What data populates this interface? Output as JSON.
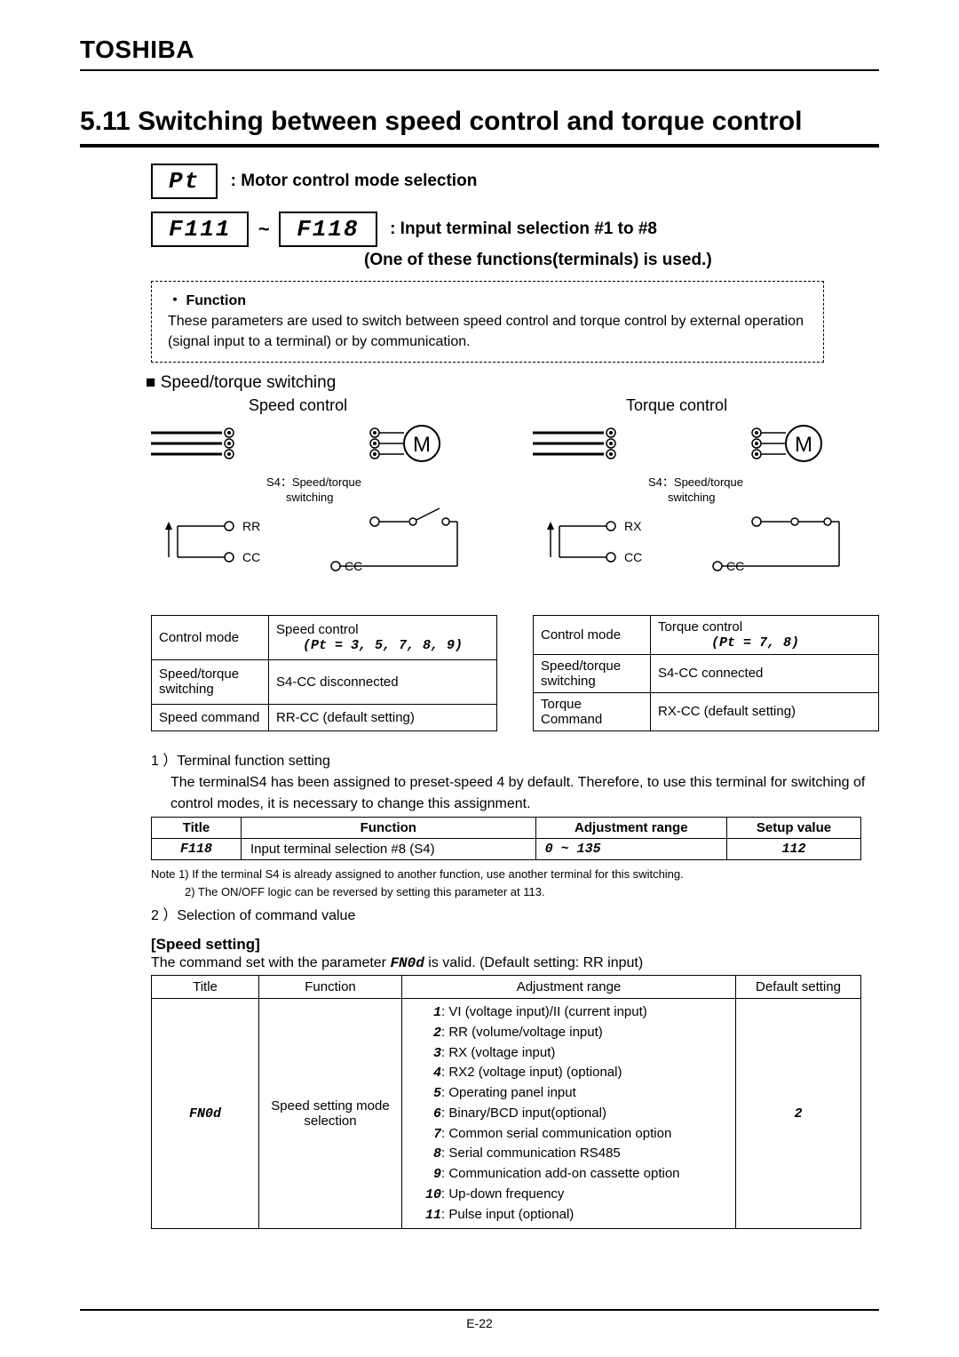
{
  "brand": "TOSHIBA",
  "section_title": "5.11 Switching between speed control and torque control",
  "param1": {
    "code": "Pt",
    "label": ": Motor control mode selection"
  },
  "param2": {
    "code_a": "F111",
    "tilde": "~",
    "code_b": "F118",
    "label": ": Input terminal selection #1 to #8",
    "sublabel": "(One of these functions(terminals) is used.)"
  },
  "function_box": {
    "title": "・ Function",
    "text": "These parameters are used to switch between speed control and torque control by external operation (signal input to a terminal) or by communication."
  },
  "switch_title": "Speed/torque switching",
  "diag_left": {
    "title": "Speed control",
    "s4_label": "S4：Speed/torque",
    "s4_sub": "switching",
    "t1": "RR",
    "t2": "CC",
    "t3": "CC"
  },
  "diag_right": {
    "title": "Torque control",
    "s4_label": "S4：Speed/torque",
    "s4_sub": "switching",
    "t1": "RX",
    "t2": "CC",
    "t3": "CC"
  },
  "tinytables": {
    "left": {
      "r1c1": "Control mode",
      "r1c2a": "Speed control",
      "r1c2b": "(Pt = 3, 5, 7, 8, 9)",
      "r2c1": "Speed/torque switching",
      "r2c2": "S4-CC disconnected",
      "r3c1": "Speed command",
      "r3c2": "RR-CC (default setting)"
    },
    "right": {
      "r1c1": "Control mode",
      "r1c2a": "Torque control",
      "r1c2b": "(Pt = 7, 8)",
      "r2c1": "Speed/torque switching",
      "r2c2": "S4-CC connected",
      "r3c1": "Torque Command",
      "r3c2": "RX-CC (default setting)"
    }
  },
  "step1": {
    "num": "1 ）Terminal function setting",
    "text": "The terminalS4 has been assigned to preset-speed 4 by default. Therefore, to use this terminal for switching of control modes, it is necessary to change this assignment."
  },
  "table1": {
    "headers": [
      "Title",
      "Function",
      "Adjustment range",
      "Setup value"
    ],
    "row": {
      "title": "F118",
      "function": "Input terminal selection #8 (S4)",
      "range": "0 ~ 135",
      "value": "112"
    }
  },
  "notes": {
    "n1": "Note 1) If the terminal S4 is already assigned to another function, use another terminal for this switching.",
    "n2": "2) The ON/OFF logic can be reversed by setting this parameter at 113."
  },
  "step2": "2 ）Selection of command value",
  "speed_setting_label": "[Speed setting]",
  "speed_setting_line_a": "The command set with the parameter ",
  "speed_setting_code": "FN0d",
  "speed_setting_line_b": " is valid.  (Default setting: RR input)",
  "table2": {
    "headers": [
      "Title",
      "Function",
      "Adjustment range",
      "Default setting"
    ],
    "row": {
      "title": "FN0d",
      "function": "Speed setting mode selection",
      "range": [
        "1: VI (voltage input)/II (current input)",
        "2: RR (volume/voltage input)",
        "3: RX (voltage input)",
        "4: RX2 (voltage input) (optional)",
        "5: Operating panel input",
        "6: Binary/BCD input(optional)",
        "7: Common serial communication option",
        "8: Serial communication RS485",
        "9: Communication add-on cassette option",
        "10: Up-down frequency",
        "11: Pulse input (optional)"
      ],
      "default": "2"
    }
  },
  "page_num": "E-22"
}
